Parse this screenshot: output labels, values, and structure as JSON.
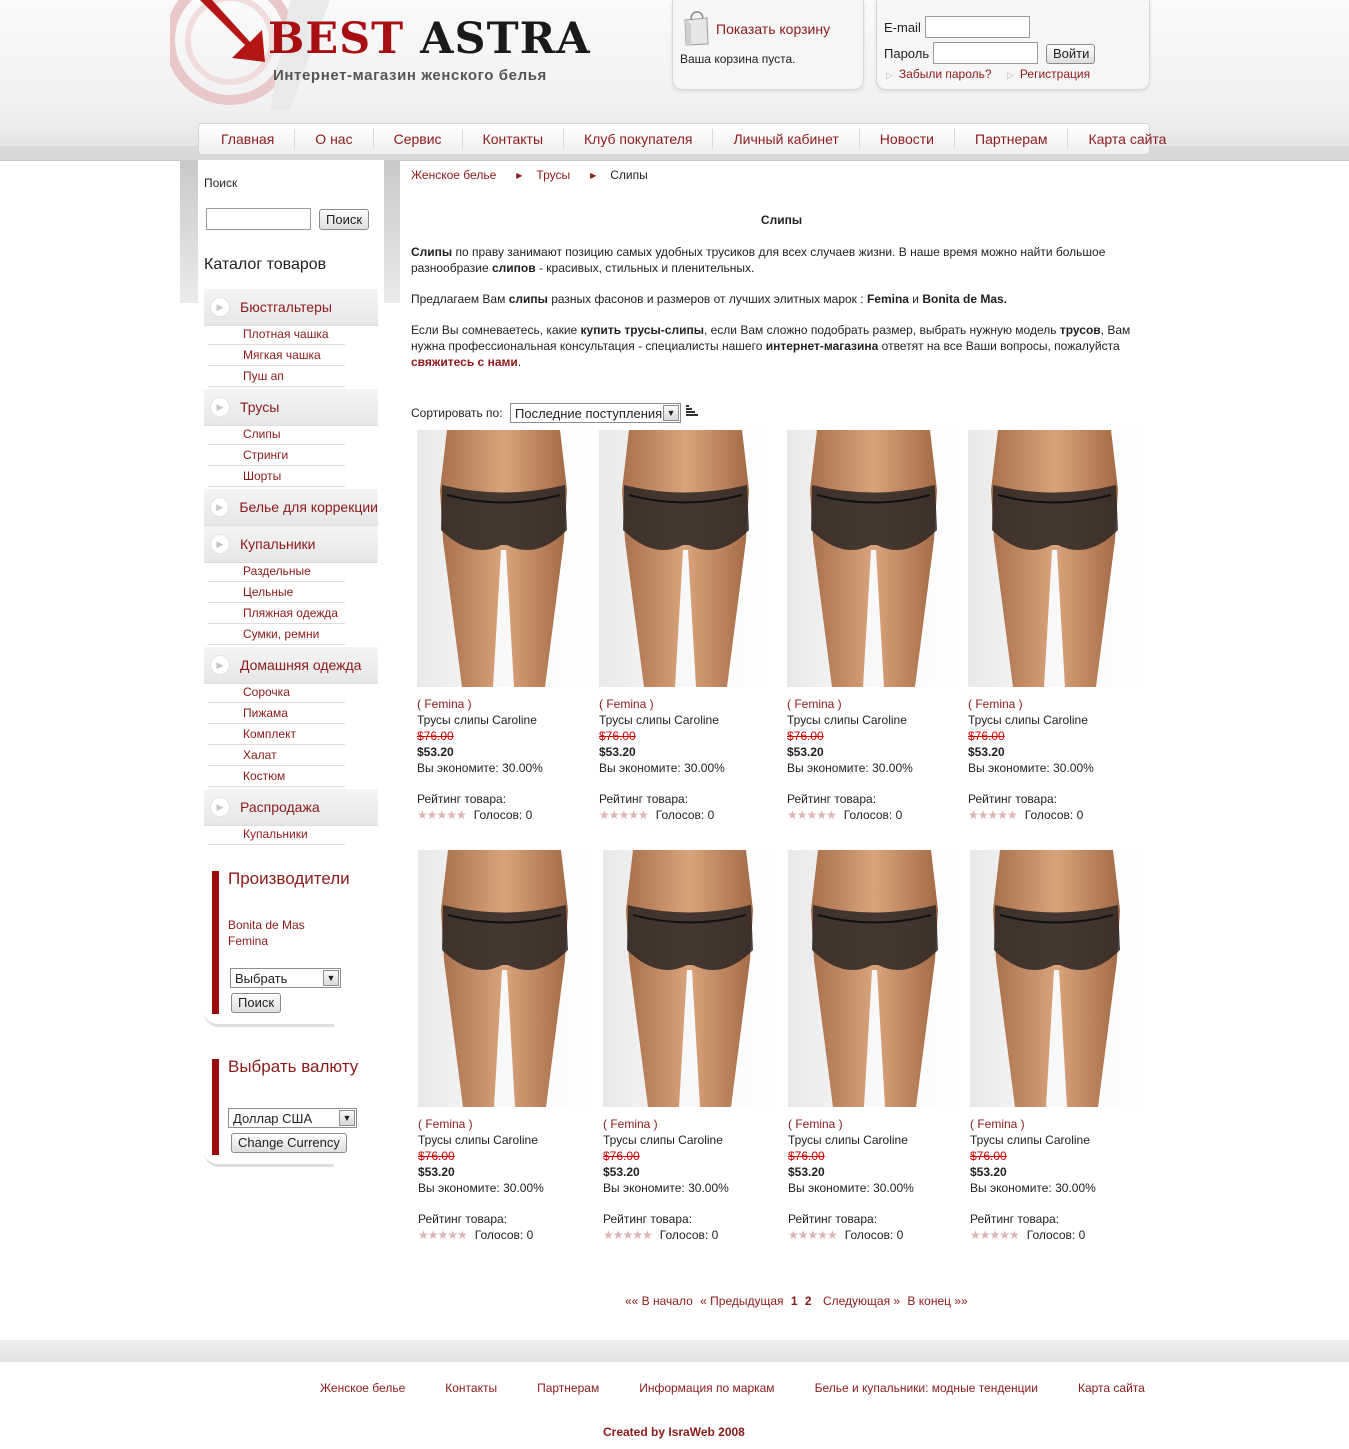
{
  "header": {
    "logo_best": "BEST",
    "logo_astra": "ASTRA",
    "logo_subtitle": "Интернет-магазин женского белья",
    "cart_link": "Показать корзину",
    "cart_status": "Ваша корзина пуста.",
    "email_label": "E-mail",
    "password_label": "Пароль",
    "login_button": "Войти",
    "forgot_password": "Забыли пароль?",
    "register": "Регистрация"
  },
  "nav": [
    "Главная",
    "О нас",
    "Сервис",
    "Контакты",
    "Клуб покупателя",
    "Личный кабинет",
    "Новости",
    "Партнерам",
    "Карта сайта"
  ],
  "sidebar": {
    "search_label": "Поиск",
    "search_button": "Поиск",
    "catalog_title": "Каталог товаров",
    "categories": [
      {
        "label": "Бюстгальтеры",
        "subs": [
          "Плотная чашка",
          "Мягкая чашка",
          "Пуш ап"
        ]
      },
      {
        "label": "Трусы",
        "subs": [
          "Слипы",
          "Стринги",
          "Шорты"
        ]
      },
      {
        "label": "Белье для коррекции",
        "subs": []
      },
      {
        "label": "Купальники",
        "subs": [
          "Раздельные",
          "Цельные",
          "Пляжная одежда",
          "Сумки, ремни"
        ]
      },
      {
        "label": "Домашняя одежда",
        "subs": [
          "Сорочка",
          "Пижама",
          "Комплект",
          "Халат",
          "Костюм"
        ]
      },
      {
        "label": "Распродажа",
        "subs": [
          "Купальники"
        ]
      }
    ],
    "manufacturers": {
      "title": "Производители",
      "items": [
        "Bonita de Mas",
        "Femina"
      ],
      "select_value": "Выбрать",
      "button": "Поиск"
    },
    "currency": {
      "title": "Выбрать валюту",
      "select_value": "Доллар США",
      "button": "Change Currency"
    }
  },
  "breadcrumb": [
    "Женское белье",
    "Трусы",
    "Слипы"
  ],
  "page_title": "Слипы",
  "intro": {
    "p1_b1": "Слипы",
    "p1_t1": " по праву занимают позицию самых удобных трусиков для всех случаев жизни. В наше время можно найти большое разнообразие ",
    "p1_b2": "слипов",
    "p1_t2": " - красивых, стильных и пленительных.",
    "p2_t1": "Предлагаем Вам ",
    "p2_b1": "слипы",
    "p2_t2": " разных фасонов и размеров от лучших элитных марок : ",
    "p2_b2": "Femina",
    "p2_t3": " и ",
    "p2_b3": "Bonita de Mas.",
    "p3_t1": "Если Вы сомневаетесь, какие ",
    "p3_b1": "купить трусы-слипы",
    "p3_t2": ", если Вам сложно подобрать размер, выбрать нужную модель ",
    "p3_b2": "трусов",
    "p3_t3": ", Вам нужна профессиональная консультация - специалисты нашего ",
    "p3_b3": "интернет-магазина",
    "p3_t4": " ответят на все Ваши вопросы, пожалуйста ",
    "p3_link": "свяжитесь с нами",
    "p3_t5": "."
  },
  "sort": {
    "label": "Сортировать по:",
    "value": "Последние поступления"
  },
  "product": {
    "brand": "( Femina )",
    "name": "Трусы слипы Caroline",
    "old_price": "$76.00",
    "price": "$53.20",
    "savings": "Вы экономите: 30.00%",
    "rating_label": "Рейтинг товара:",
    "votes": "Голосов: 0"
  },
  "pager": {
    "first": "«« В начало",
    "prev": "« Предыдущая",
    "pages": [
      "1",
      "2"
    ],
    "next": "Следующая »",
    "last": "В конец »»"
  },
  "footer": {
    "links": [
      "Женское белье",
      "Контакты",
      "Партнерам",
      "Информация по маркам",
      "Белье и купальники: модные тенденции",
      "Карта сайта"
    ],
    "credit": "Created by IsraWeb 2008"
  },
  "colors": {
    "accent": "#8b1a1a",
    "logo_red": "#a80f12",
    "sidebar_bar": "#9a0c0c"
  }
}
